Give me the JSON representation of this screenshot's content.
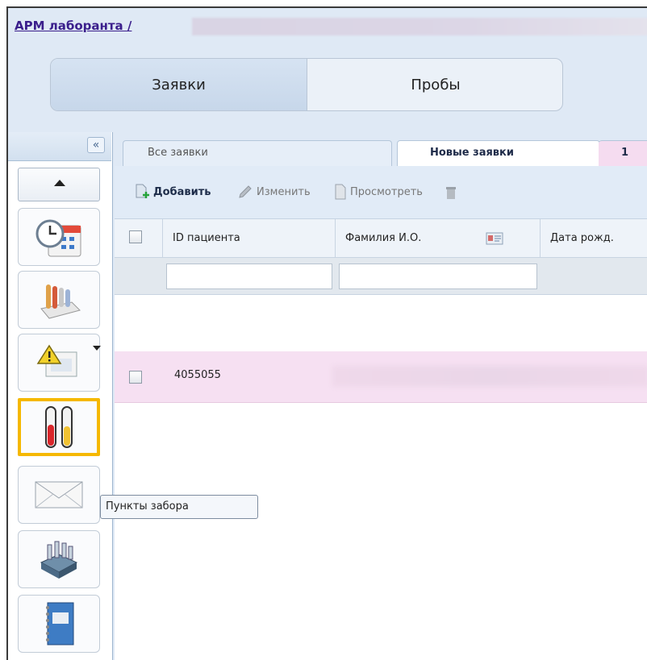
{
  "header": {
    "title": "АРМ лаборанта /"
  },
  "top_tabs": [
    {
      "label": "Заявки",
      "active": true
    },
    {
      "label": "Пробы",
      "active": false
    }
  ],
  "left_panel": {
    "collapse_symbol": "«",
    "tools": [
      {
        "icon": "calendar-clock-icon"
      },
      {
        "icon": "test-tubes-rack-icon"
      },
      {
        "icon": "warning-document-icon",
        "has_dropdown": true
      },
      {
        "icon": "sample-tubes-icon",
        "highlighted": true
      },
      {
        "icon": "envelope-icon"
      },
      {
        "icon": "lab-machine-icon"
      },
      {
        "icon": "notebook-icon"
      }
    ]
  },
  "tooltip": {
    "text": "Пункты забора"
  },
  "sub_tabs": [
    {
      "label": "Все заявки",
      "active": false
    },
    {
      "label": "Новые заявки",
      "active": true
    },
    {
      "label": "1",
      "active": false
    }
  ],
  "toolbar": {
    "add_label": "Добавить",
    "edit_label": "Изменить",
    "view_label": "Просмотреть"
  },
  "grid": {
    "columns": [
      "ID пациента",
      "Фамилия И.О.",
      "Дата рожд."
    ],
    "rows": [
      {
        "patient_id": "4055055"
      }
    ]
  },
  "colors": {
    "accent_highlight": "#f5b800",
    "row_highlight": "#f6e0f2",
    "title_link": "#3b1f8c"
  }
}
